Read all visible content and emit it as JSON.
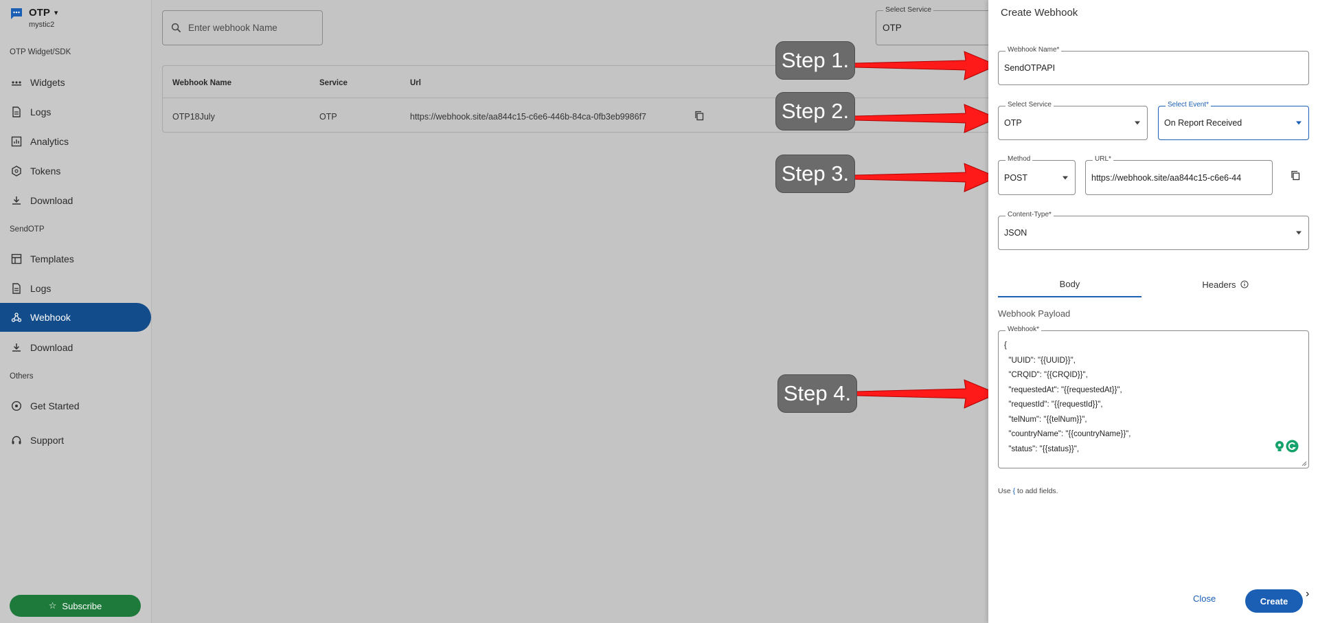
{
  "sidebar": {
    "brand": "OTP",
    "subtitle": "mystic2",
    "sections": [
      "OTP Widget/SDK",
      "SendOTP",
      "Others"
    ],
    "items": [
      {
        "label": "Widgets"
      },
      {
        "label": "Logs"
      },
      {
        "label": "Analytics"
      },
      {
        "label": "Tokens"
      },
      {
        "label": "Download"
      },
      {
        "label": "Templates"
      },
      {
        "label": "Logs"
      },
      {
        "label": "Webhook"
      },
      {
        "label": "Download"
      },
      {
        "label": "Get Started"
      },
      {
        "label": "Support"
      }
    ],
    "subscribe": "Subscribe"
  },
  "main": {
    "search_placeholder": "Enter webhook Name",
    "select_service_label": "Select Service",
    "select_service_value": "OTP",
    "table": {
      "headers": [
        "Webhook Name",
        "Service",
        "Url"
      ],
      "rows": [
        [
          "OTP18July",
          "OTP",
          "https://webhook.site/aa844c15-c6e6-446b-84ca-0fb3eb9986f7"
        ]
      ]
    }
  },
  "steps": [
    "Step 1.",
    "Step 2.",
    "Step 3.",
    "Step 4."
  ],
  "panel": {
    "title": "Create Webhook",
    "webhook_name_label": "Webhook Name*",
    "webhook_name_value": "SendOTPAPI",
    "service_label": "Select Service",
    "service_value": "OTP",
    "event_label": "Select Event*",
    "event_value": "On Report Received",
    "method_label": "Method",
    "method_value": "POST",
    "url_label": "URL*",
    "url_value": "https://webhook.site/aa844c15-c6e6-44",
    "content_type_label": "Content-Type*",
    "content_type_value": "JSON",
    "tabs": [
      "Body",
      "Headers"
    ],
    "payload_title": "Webhook Payload",
    "payload_label": "Webhook*",
    "payload_lines": [
      "{",
      "  \"UUID\": \"{{UUID}}\",",
      "  \"CRQID\": \"{{CRQID}}\",",
      "  \"requestedAt\": \"{{requestedAt}}\",",
      "  \"requestId\": \"{{requestId}}\",",
      "  \"telNum\": \"{{telNum}}\",",
      "  \"countryName\": \"{{countryName}}\",",
      "  \"status\": \"{{status}}\","
    ],
    "hint_prefix": "Use",
    "hint_brace": "{",
    "hint_suffix": "to add fields.",
    "close": "Close",
    "create": "Create"
  },
  "colors": {
    "accent": "#1a5fb4",
    "sidebar_active": "#134c8a",
    "subscribe": "#1e7a3b",
    "arrow": "#ff1a1a"
  }
}
